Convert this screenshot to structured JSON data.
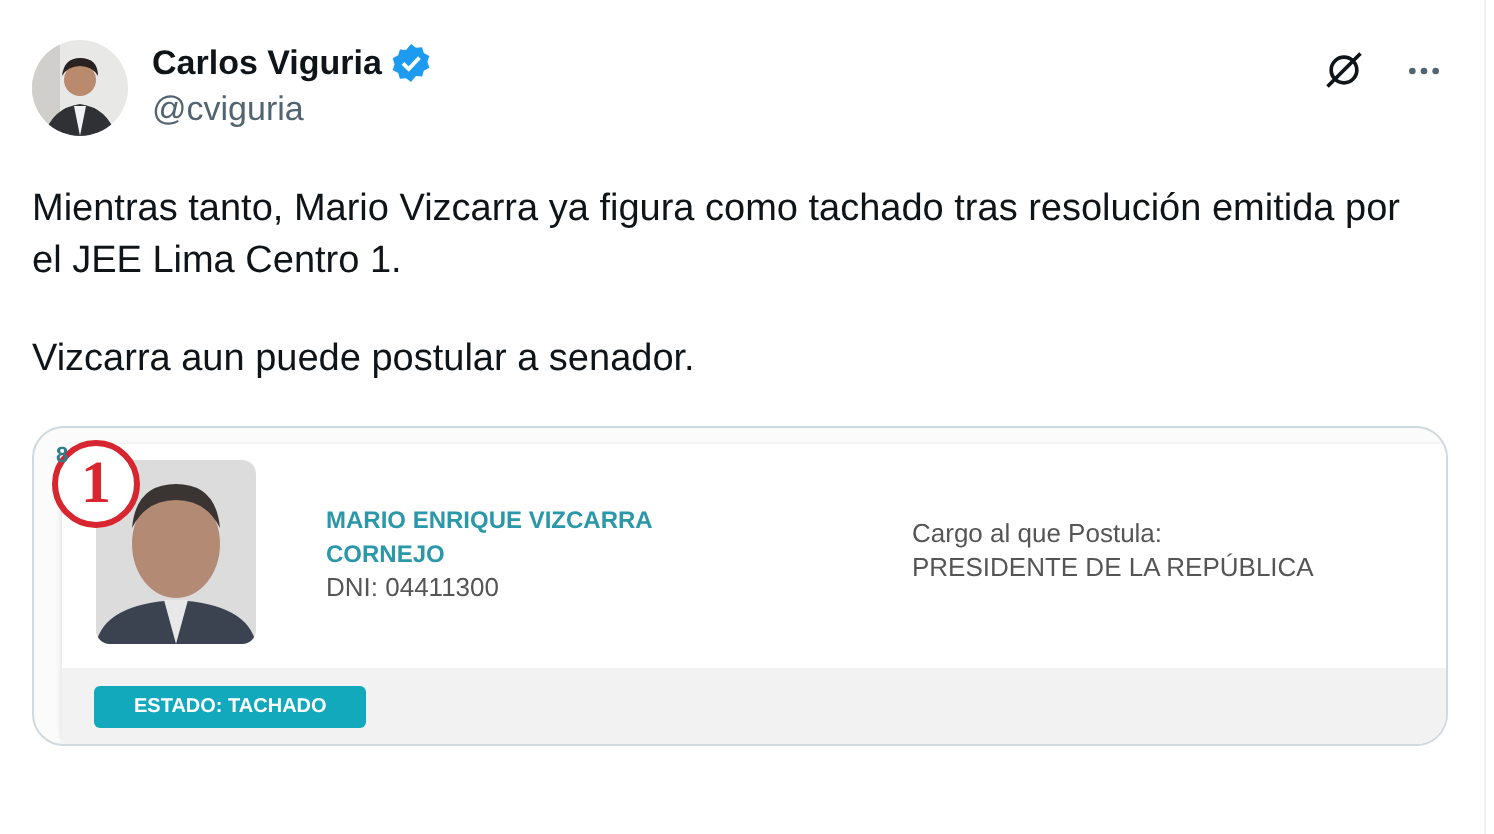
{
  "author": {
    "name": "Carlos Viguria",
    "verified": true,
    "handle": "@cviguria"
  },
  "text": [
    "Mientras tanto, Mario Vizcarra ya figura como tachado tras resolución emitida por el JEE Lima Centro 1.",
    "Vizcarra aun puede postular a senador."
  ],
  "candidate": {
    "list_number": "8",
    "party_number": "1",
    "name": "MARIO ENRIQUE VIZCARRA CORNEJO",
    "dni": "DNI: 04411300",
    "office_label": "Cargo al que Postula:",
    "office": "PRESIDENTE DE LA REPÚBLICA",
    "status": "ESTADO: TACHADO"
  }
}
